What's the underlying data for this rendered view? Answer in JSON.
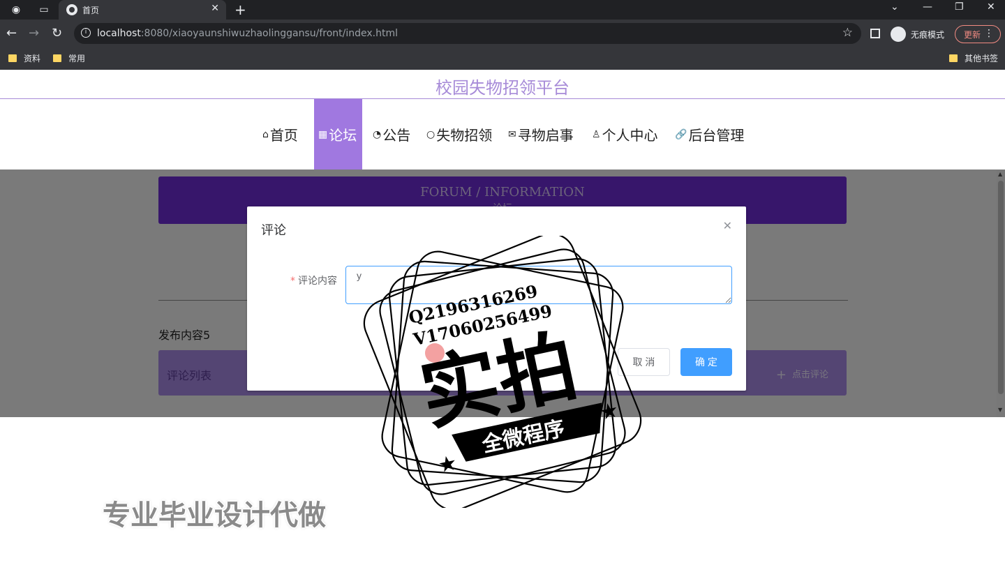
{
  "browser": {
    "tab_title": "首页",
    "url_host": "localhost",
    "url_rest": ":8080/xiaoyaunshiwuzhaolinggansu/front/index.html",
    "incognito_label": "无痕模式",
    "update_label": "更新",
    "bookmarks": [
      "资料",
      "常用"
    ],
    "other_bookmarks": "其他书签"
  },
  "site": {
    "title": "校园失物招领平台",
    "accent_color": "#a078e0",
    "nav": [
      {
        "icon": "home-icon",
        "label": "首页"
      },
      {
        "icon": "forum-icon",
        "label": "论坛"
      },
      {
        "icon": "notice-icon",
        "label": "公告"
      },
      {
        "icon": "lost-found-icon",
        "label": "失物招领"
      },
      {
        "icon": "mail-icon",
        "label": "寻物启事"
      },
      {
        "icon": "user-icon",
        "label": "个人中心"
      },
      {
        "icon": "link-icon",
        "label": "后台管理"
      }
    ],
    "active_nav": "论坛"
  },
  "content": {
    "banner_en": "FORUM / INFORMATION",
    "banner_cn": "论坛",
    "post_content": "发布内容5",
    "comment_list_label": "评论列表",
    "add_comment_label": "点击评论"
  },
  "dialog": {
    "title": "评论",
    "field_label": "评论内容",
    "field_value": "y",
    "cancel_label": "取 消",
    "confirm_label": "确 定"
  },
  "watermark": {
    "line1": "Q2196316269",
    "line2": "V17060256499",
    "big": "实拍",
    "banner": "全微程序",
    "bottom_text": "专业毕业设计代做"
  }
}
